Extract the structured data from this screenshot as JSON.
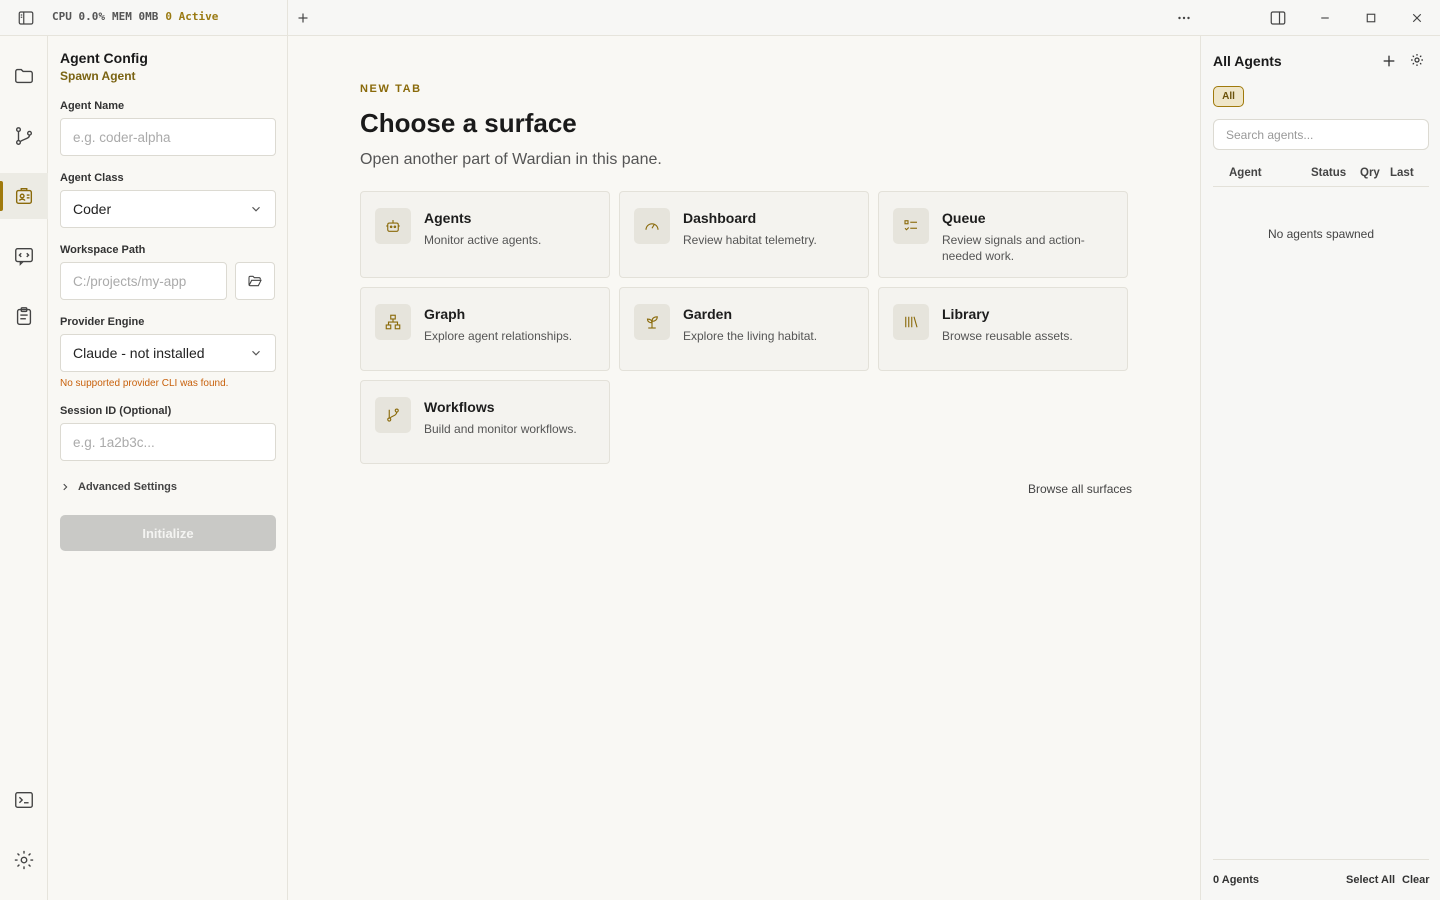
{
  "topbar": {
    "cpu": "CPU 0.0%",
    "mem": "MEM 0MB",
    "active": "0 Active"
  },
  "config": {
    "title": "Agent Config",
    "subtitle": "Spawn Agent",
    "agent_name": {
      "label": "Agent Name",
      "placeholder": "e.g. coder-alpha"
    },
    "agent_class": {
      "label": "Agent Class",
      "value": "Coder"
    },
    "workspace": {
      "label": "Workspace Path",
      "placeholder": "C:/projects/my-app"
    },
    "provider": {
      "label": "Provider Engine",
      "value": "Claude - not installed",
      "error": "No supported provider CLI was found."
    },
    "session": {
      "label": "Session ID (Optional)",
      "placeholder": "e.g. 1a2b3c..."
    },
    "advanced": "Advanced Settings",
    "init": "Initialize"
  },
  "main": {
    "eyebrow": "NEW TAB",
    "title": "Choose a surface",
    "lead": "Open another part of Wardian in this pane.",
    "cards": [
      {
        "title": "Agents",
        "desc": "Monitor active agents.",
        "icon": "robot-icon"
      },
      {
        "title": "Dashboard",
        "desc": "Review habitat telemetry.",
        "icon": "gauge-icon"
      },
      {
        "title": "Queue",
        "desc": "Review signals and action-needed work.",
        "icon": "checklist-icon"
      },
      {
        "title": "Graph",
        "desc": "Explore agent relationships.",
        "icon": "hierarchy-icon"
      },
      {
        "title": "Garden",
        "desc": "Explore the living habitat.",
        "icon": "sprout-icon"
      },
      {
        "title": "Library",
        "desc": "Browse reusable assets.",
        "icon": "library-icon"
      },
      {
        "title": "Workflows",
        "desc": "Build and monitor workflows.",
        "icon": "branch-icon"
      }
    ],
    "browse_all": "Browse all surfaces"
  },
  "agents_panel": {
    "title": "All Agents",
    "filter": "All",
    "search_placeholder": "Search agents...",
    "columns": [
      "Agent",
      "Status",
      "Qry",
      "Last"
    ],
    "empty": "No agents spawned",
    "count": "0 Agents",
    "select_all": "Select All",
    "clear": "Clear"
  },
  "colors": {
    "accent": "#a07a0c",
    "error": "#c8610c",
    "background": "#f9f8f4"
  }
}
